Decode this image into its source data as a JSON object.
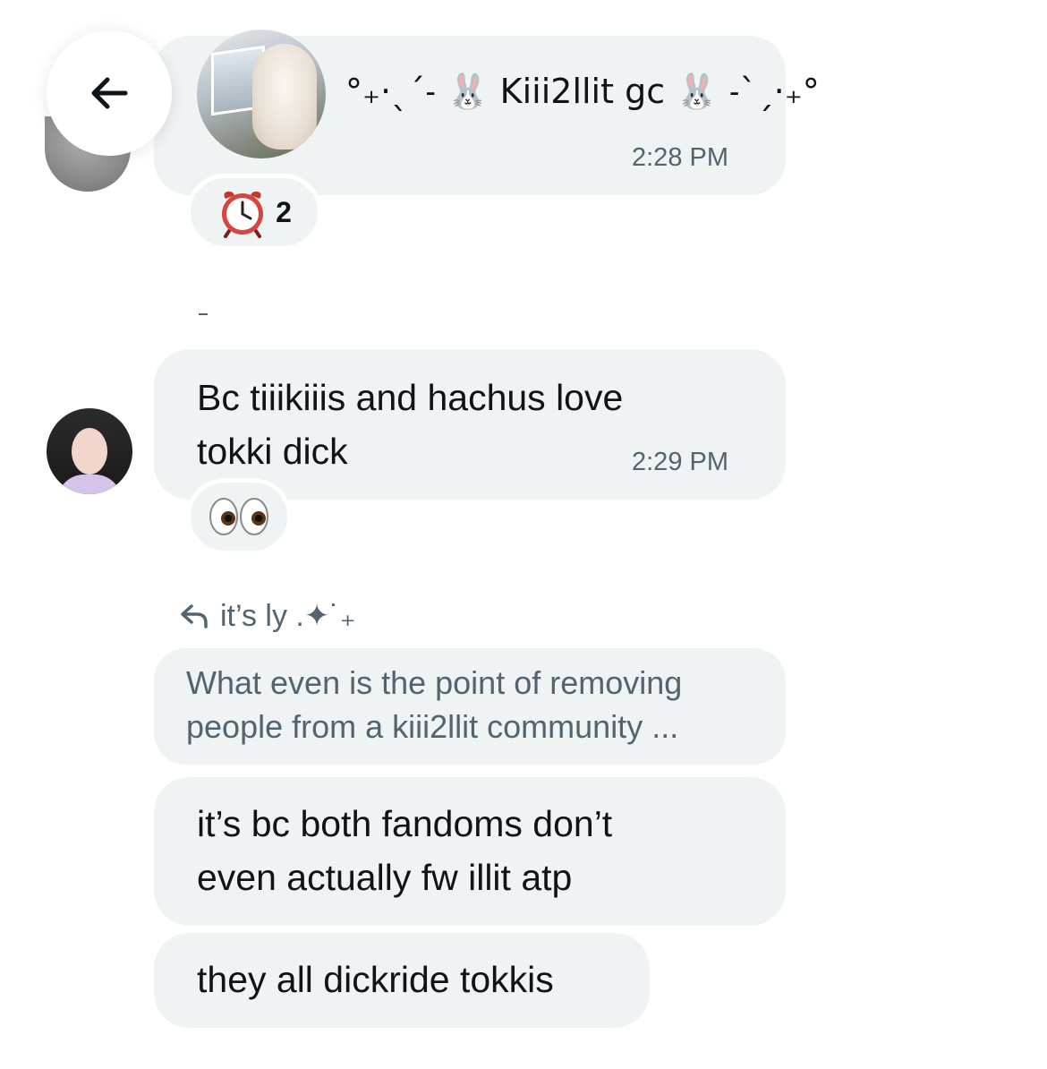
{
  "shared_card": {
    "title": "°₊·ˎˊ˗ 🐰 Kiii2llit gc 🐰 ˗ˋˏ·₊°",
    "time": "2:28 PM",
    "reaction_count": "2"
  },
  "messages": [
    {
      "text_line1": "Bc tiiikiiis and hachus love",
      "text_line2": "tokki dick",
      "time": "2:29 PM"
    }
  ],
  "reply": {
    "author": "it’s ly .✦˙₊",
    "quoted_line1": "What even is the point of removing",
    "quoted_line2": "people from a kiii2llit community ..."
  },
  "own_messages": [
    {
      "line1": "it’s bc both fandoms don’t",
      "line2": "even actually fw illit atp"
    },
    {
      "line1": "they all dickride tokkis"
    }
  ],
  "icons": {
    "back": "arrow-left-icon",
    "clock_reaction": "alarm-clock-icon",
    "eyes_reaction": "eyes-icon",
    "reply": "reply-arrow-icon"
  }
}
